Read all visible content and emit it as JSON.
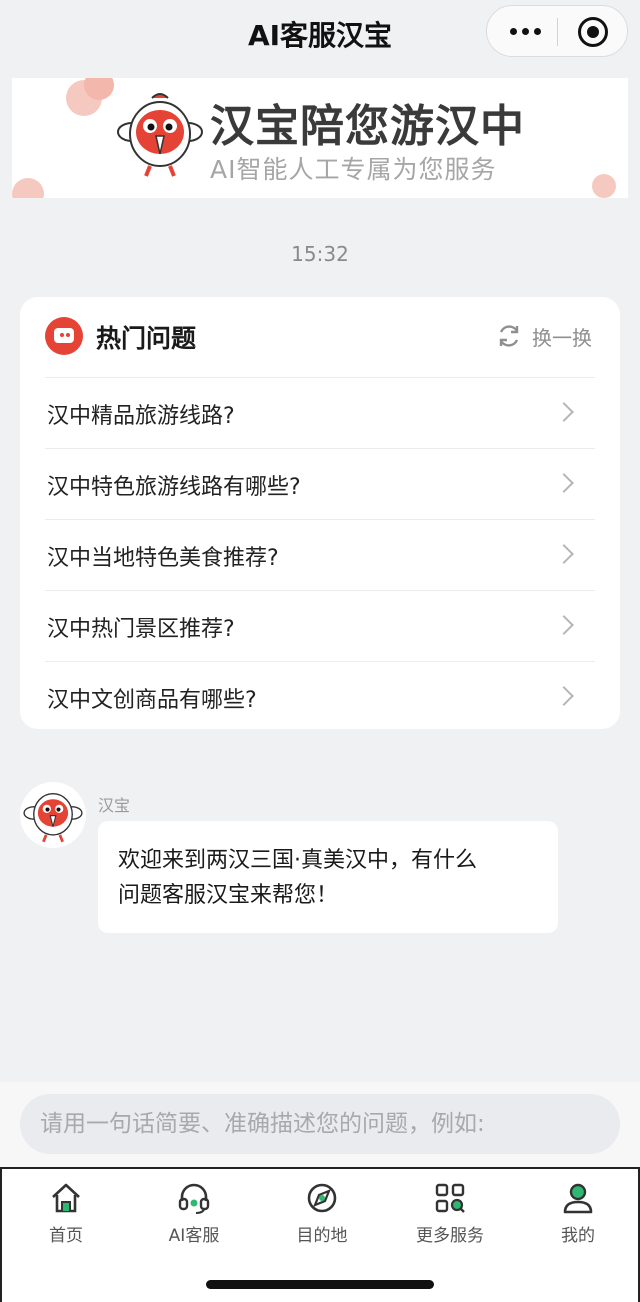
{
  "titlebar": {
    "title": "AI客服汉宝",
    "more_icon": "more-dots-icon",
    "close_icon": "target-circle-icon"
  },
  "banner": {
    "headline": "汉宝陪您游汉中",
    "subline": "AI智能人工专属为您服务",
    "mascot": "red-bird-mascot"
  },
  "chat": {
    "timestamp": "15:32",
    "hot_questions": {
      "title": "热门问题",
      "refresh_label": "换一换",
      "icon": "chat-bubble-icon",
      "items": [
        {
          "text": "汉中精品旅游线路?"
        },
        {
          "text": "汉中特色旅游线路有哪些?"
        },
        {
          "text": "汉中当地特色美食推荐?"
        },
        {
          "text": "汉中热门景区推荐?"
        },
        {
          "text": "汉中文创商品有哪些?"
        }
      ]
    },
    "message": {
      "sender": "汉宝",
      "line1": "欢迎来到两汉三国·真美汉中，有什么",
      "line2": "问题客服汉宝来帮您！"
    }
  },
  "input": {
    "placeholder": "请用一句话简要、准确描述您的问题，例如:"
  },
  "tabbar": {
    "tabs": [
      {
        "label": "首页",
        "icon": "home-icon"
      },
      {
        "label": "AI客服",
        "icon": "headset-icon"
      },
      {
        "label": "目的地",
        "icon": "compass-icon"
      },
      {
        "label": "更多服务",
        "icon": "grid-search-icon"
      },
      {
        "label": "我的",
        "icon": "user-icon"
      }
    ]
  },
  "colors": {
    "accent_red": "#e54335",
    "background": "#f0f1f3",
    "tab_icon": "#333333"
  }
}
